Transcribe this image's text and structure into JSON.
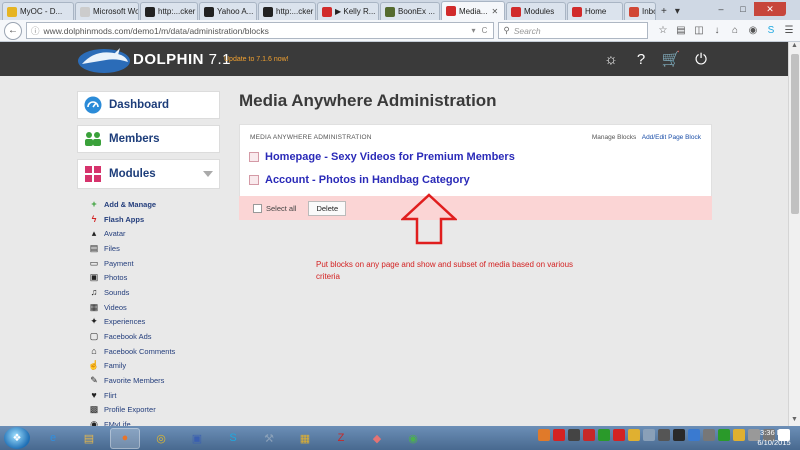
{
  "browser": {
    "tabs": [
      {
        "label": "MyOC - D...",
        "color": "#e6b422",
        "active": false
      },
      {
        "label": "Microsoft Wo...",
        "color": "#cccccc",
        "active": false
      },
      {
        "label": "http:...cker",
        "color": "#222222",
        "active": false
      },
      {
        "label": "Yahoo A...",
        "color": "#222222",
        "active": false
      },
      {
        "label": "http:...cker",
        "color": "#222222",
        "active": false
      },
      {
        "label": "▶ Kelly R...",
        "color": "#d12b2b",
        "active": false
      },
      {
        "label": "BoonEx ...",
        "color": "#556b2f",
        "active": false
      },
      {
        "label": "Media...",
        "color": "#d12b2b",
        "active": true
      },
      {
        "label": "Modules",
        "color": "#d12b2b",
        "active": false
      },
      {
        "label": "Home",
        "color": "#d12b2b",
        "active": false
      },
      {
        "label": "Inbo",
        "color": "#d14836",
        "active": false
      }
    ],
    "new_tab": "+",
    "tab_menu": "▾",
    "url": "www.dolphinmods.com/demo1/m/data/administration/blocks",
    "url_right": "▾ C",
    "search_placeholder": "Search"
  },
  "site": {
    "brand": "DOLPHIN",
    "version": "7.1",
    "update_text": "Update to 7.1.6 now!"
  },
  "sidebar": {
    "dashboard": "Dashboard",
    "members": "Members",
    "modules": "Modules",
    "module_items": [
      {
        "label": "Add & Manage",
        "icon": "+",
        "icon_color": "#2a9a2a",
        "bold": true
      },
      {
        "label": "Flash Apps",
        "icon": "ϟ",
        "icon_color": "#d32222",
        "bold": true
      },
      {
        "label": "Avatar",
        "icon": "▴",
        "icon_color": "#222222",
        "bold": false
      },
      {
        "label": "Files",
        "icon": "▤",
        "icon_color": "#222222",
        "bold": false
      },
      {
        "label": "Payment",
        "icon": "▭",
        "icon_color": "#222222",
        "bold": false
      },
      {
        "label": "Photos",
        "icon": "▣",
        "icon_color": "#222222",
        "bold": false
      },
      {
        "label": "Sounds",
        "icon": "♫",
        "icon_color": "#222222",
        "bold": false
      },
      {
        "label": "Videos",
        "icon": "▦",
        "icon_color": "#222222",
        "bold": false
      },
      {
        "label": "Experiences",
        "icon": "✦",
        "icon_color": "#222222",
        "bold": false
      },
      {
        "label": "Facebook Ads",
        "icon": "▢",
        "icon_color": "#222222",
        "bold": false
      },
      {
        "label": "Facebook Comments",
        "icon": "⌂",
        "icon_color": "#222222",
        "bold": false
      },
      {
        "label": "Family",
        "icon": "☝",
        "icon_color": "#222222",
        "bold": false
      },
      {
        "label": "Favorite Members",
        "icon": "✎",
        "icon_color": "#222222",
        "bold": false
      },
      {
        "label": "Flirt",
        "icon": "♥",
        "icon_color": "#222222",
        "bold": false
      },
      {
        "label": "Profile Exporter",
        "icon": "▩",
        "icon_color": "#222222",
        "bold": false
      },
      {
        "label": "FMyLife",
        "icon": "◉",
        "icon_color": "#222222",
        "bold": false
      }
    ]
  },
  "main": {
    "title": "Media Anywhere Administration",
    "panel_heading": "MEDIA ANYWHERE ADMINISTRATION",
    "manage_blocks": "Manage Blocks",
    "add_edit_block": "Add/Edit Page Block",
    "blocks": [
      "Homepage - Sexy Videos for Premium Members",
      "Account - Photos in Handbag Category"
    ],
    "select_all": "Select all",
    "delete_button": "Delete",
    "annotation": "Put blocks on any page and show and subset of media based on various criteria"
  },
  "taskbar": {
    "time": "3:36 PM",
    "date": "6/10/2015",
    "apps": [
      {
        "name": "ie",
        "glyph": "e",
        "color": "#2f8fe0"
      },
      {
        "name": "explorer",
        "glyph": "▤",
        "color": "#e8b84a"
      },
      {
        "name": "firefox",
        "glyph": "●",
        "color": "#e8742a"
      },
      {
        "name": "chrome",
        "glyph": "◎",
        "color": "#e2b92b"
      },
      {
        "name": "network",
        "glyph": "▣",
        "color": "#3a5fb0"
      },
      {
        "name": "skype",
        "glyph": "S",
        "color": "#1ea8e0"
      },
      {
        "name": "tools",
        "glyph": "⚒",
        "color": "#8aa0b8"
      },
      {
        "name": "folder",
        "glyph": "▦",
        "color": "#e0b030"
      },
      {
        "name": "filezilla",
        "glyph": "Z",
        "color": "#c62828"
      },
      {
        "name": "eraser",
        "glyph": "◆",
        "color": "#e57373"
      },
      {
        "name": "frog",
        "glyph": "◉",
        "color": "#4caf50"
      }
    ],
    "tray_colors": [
      "#e07a2a",
      "#d32222",
      "#444444",
      "#c62828",
      "#2a9a2a",
      "#d32222",
      "#e0b030",
      "#8aa0b8",
      "#555555",
      "#2a2a2a",
      "#3a7ad0",
      "#777777",
      "#2a9a2a",
      "#e0b030",
      "#999999",
      "#777777",
      "#ffffff"
    ]
  }
}
